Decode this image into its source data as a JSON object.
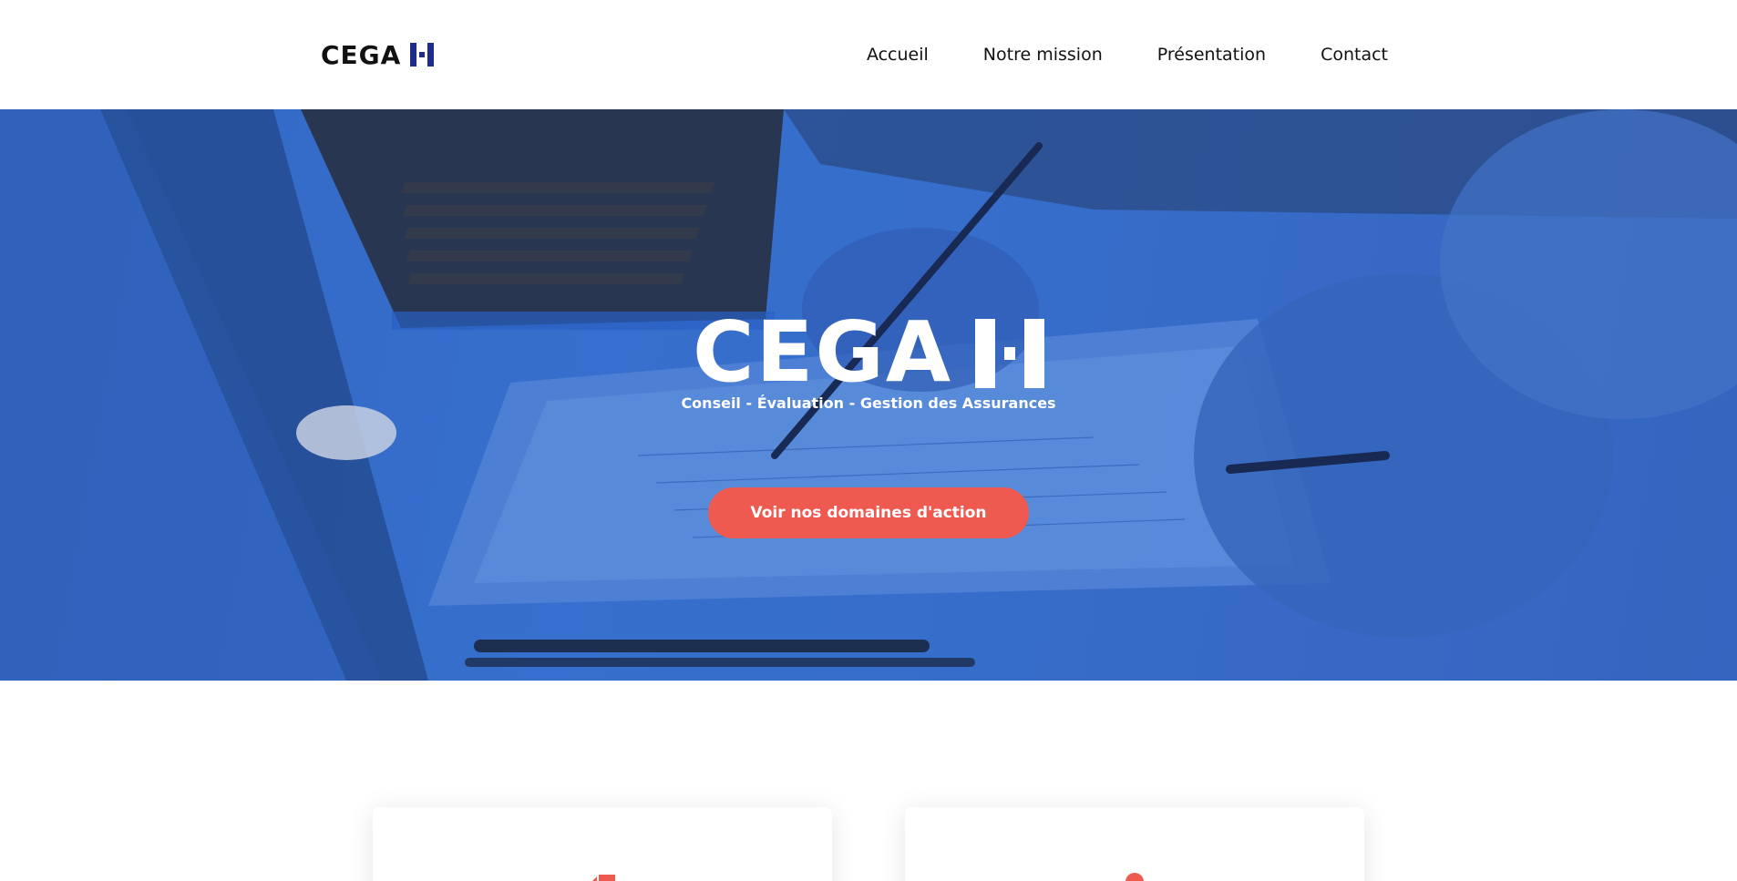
{
  "brand": {
    "name": "CEGA",
    "tagline": "Conseil - Évaluation - Gestion des Assurances",
    "accent": "#1f2c8f"
  },
  "nav": {
    "items": [
      "Accueil",
      "Notre mission",
      "Présentation",
      "Contact"
    ]
  },
  "hero": {
    "cta_label": "Voir nos domaines d'action",
    "cta_color": "#ee5a4f",
    "overlay_color": "#3d78dc"
  },
  "cards": [
    {
      "icon": "document-icon"
    },
    {
      "icon": "pin-icon"
    }
  ]
}
